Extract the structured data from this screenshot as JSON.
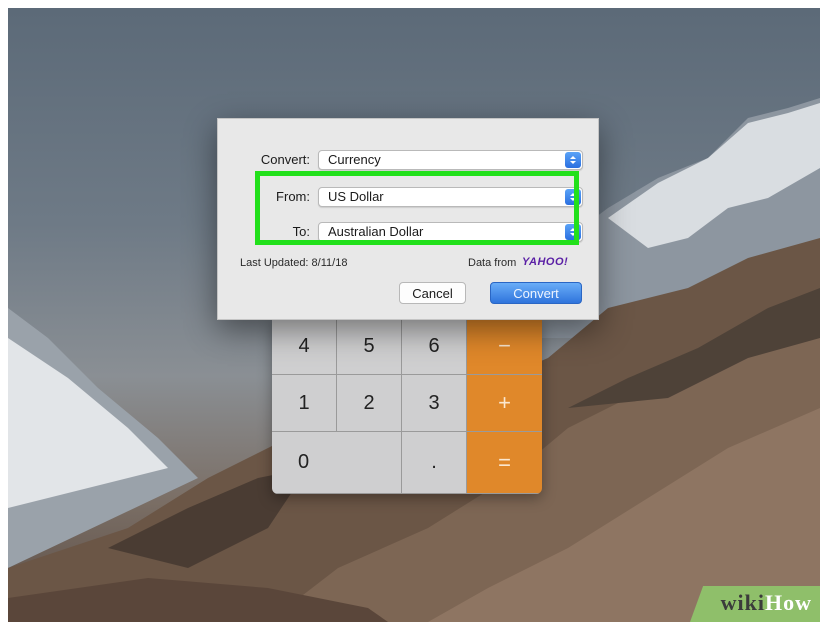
{
  "dialog": {
    "convert_label": "Convert:",
    "convert_value": "Currency",
    "from_label": "From:",
    "from_value": "US Dollar",
    "to_label": "To:",
    "to_value": "Australian Dollar",
    "last_updated": "Last Updated: 8/11/18",
    "data_from": "Data from",
    "provider": "YAHOO!",
    "cancel_label": "Cancel",
    "convert_button_label": "Convert"
  },
  "calculator": {
    "keys": [
      "4",
      "5",
      "6",
      "−",
      "1",
      "2",
      "3",
      "+",
      "0",
      ".",
      "="
    ]
  },
  "watermark": {
    "part1": "wiki",
    "part2": "How"
  },
  "colors": {
    "highlight": "#22e01b",
    "operator": "#e0882a",
    "accent": "#2f74dc"
  },
  "icons": {
    "stepper": "up-down-chevron-icon"
  }
}
